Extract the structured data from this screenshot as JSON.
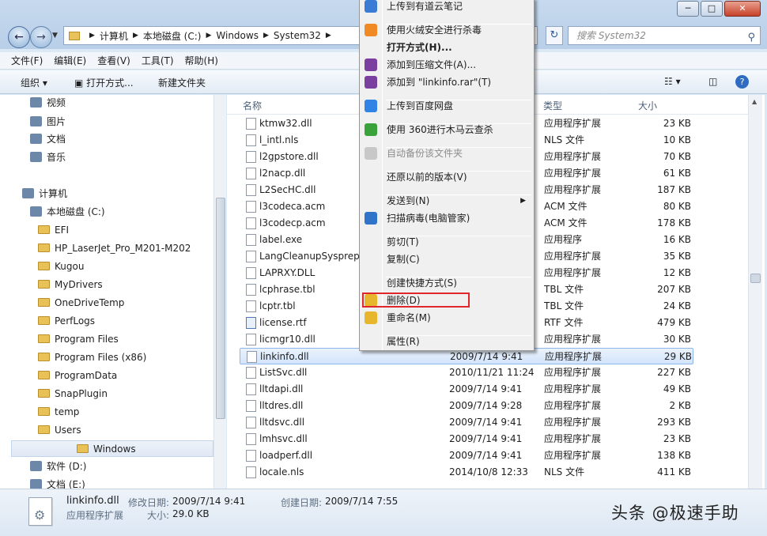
{
  "window": {
    "controls": [
      "─",
      "□",
      "✕"
    ]
  },
  "address": {
    "crumbs": [
      "计算机",
      "本地磁盘 (C:)",
      "Windows",
      "System32"
    ]
  },
  "search": {
    "placeholder": "搜索 System32"
  },
  "menubar": [
    "文件(F)",
    "编辑(E)",
    "查看(V)",
    "工具(T)",
    "帮助(H)"
  ],
  "toolbar": {
    "organize": "组织 ▾",
    "open": "打开方式...",
    "new_folder": "新建文件夹"
  },
  "nav": {
    "items": [
      {
        "label": "视频",
        "icon": "video-icon"
      },
      {
        "label": "图片",
        "icon": "picture-icon"
      },
      {
        "label": "文档",
        "icon": "document-icon"
      },
      {
        "label": "音乐",
        "icon": "music-icon"
      },
      {
        "label": "计算机",
        "icon": "computer-icon"
      },
      {
        "label": "本地磁盘 (C:)",
        "icon": "drive-icon"
      },
      {
        "label": "EFI",
        "icon": "folder-icon"
      },
      {
        "label": "HP_LaserJet_Pro_M201-M202",
        "icon": "folder-icon"
      },
      {
        "label": "Kugou",
        "icon": "folder-icon"
      },
      {
        "label": "MyDrivers",
        "icon": "folder-icon"
      },
      {
        "label": "OneDriveTemp",
        "icon": "folder-icon"
      },
      {
        "label": "PerfLogs",
        "icon": "folder-icon"
      },
      {
        "label": "Program Files",
        "icon": "folder-icon"
      },
      {
        "label": "Program Files (x86)",
        "icon": "folder-icon"
      },
      {
        "label": "ProgramData",
        "icon": "folder-icon"
      },
      {
        "label": "SnapPlugin",
        "icon": "folder-icon"
      },
      {
        "label": "temp",
        "icon": "folder-icon"
      },
      {
        "label": "Users",
        "icon": "folder-icon"
      },
      {
        "label": "Windows",
        "icon": "folder-icon"
      },
      {
        "label": "软件 (D:)",
        "icon": "drive-icon"
      },
      {
        "label": "文档 (E:)",
        "icon": "drive-icon"
      }
    ]
  },
  "columns": {
    "name": "名称",
    "type": "类型",
    "size": "大小"
  },
  "files": [
    {
      "name": "ktmw32.dll",
      "date": "",
      "type": "应用程序扩展",
      "size": "23 KB"
    },
    {
      "name": "l_intl.nls",
      "date": "",
      "type": "NLS 文件",
      "size": "10 KB"
    },
    {
      "name": "l2gpstore.dll",
      "date": "",
      "type": "应用程序扩展",
      "size": "70 KB"
    },
    {
      "name": "l2nacp.dll",
      "date": "",
      "type": "应用程序扩展",
      "size": "61 KB"
    },
    {
      "name": "L2SecHC.dll",
      "date": "",
      "type": "应用程序扩展",
      "size": "187 KB"
    },
    {
      "name": "l3codeca.acm",
      "date": "",
      "type": "ACM 文件",
      "size": "80 KB"
    },
    {
      "name": "l3codecp.acm",
      "date": "",
      "type": "ACM 文件",
      "size": "178 KB"
    },
    {
      "name": "label.exe",
      "date": "",
      "type": "应用程序",
      "size": "16 KB"
    },
    {
      "name": "LangCleanupSysprepA",
      "date": "",
      "type": "应用程序扩展",
      "size": "35 KB"
    },
    {
      "name": "LAPRXY.DLL",
      "date": "",
      "type": "应用程序扩展",
      "size": "12 KB"
    },
    {
      "name": "lcphrase.tbl",
      "date": "",
      "type": "TBL 文件",
      "size": "207 KB"
    },
    {
      "name": "lcptr.tbl",
      "date": "",
      "type": "TBL 文件",
      "size": "24 KB"
    },
    {
      "name": "license.rtf",
      "date": "",
      "type": "RTF 文件",
      "size": "479 KB"
    },
    {
      "name": "licmgr10.dll",
      "date": "",
      "type": "应用程序扩展",
      "size": "30 KB"
    },
    {
      "name": "linkinfo.dll",
      "date": "2009/7/14 9:41",
      "type": "应用程序扩展",
      "size": "29 KB"
    },
    {
      "name": "ListSvc.dll",
      "date": "2010/11/21 11:24",
      "type": "应用程序扩展",
      "size": "227 KB"
    },
    {
      "name": "lltdapi.dll",
      "date": "2009/7/14 9:41",
      "type": "应用程序扩展",
      "size": "49 KB"
    },
    {
      "name": "lltdres.dll",
      "date": "2009/7/14 9:28",
      "type": "应用程序扩展",
      "size": "2 KB"
    },
    {
      "name": "lltdsvc.dll",
      "date": "2009/7/14 9:41",
      "type": "应用程序扩展",
      "size": "293 KB"
    },
    {
      "name": "lmhsvc.dll",
      "date": "2009/7/14 9:41",
      "type": "应用程序扩展",
      "size": "23 KB"
    },
    {
      "name": "loadperf.dll",
      "date": "2009/7/14 9:41",
      "type": "应用程序扩展",
      "size": "138 KB"
    },
    {
      "name": "locale.nls",
      "date": "2014/10/8 12:33",
      "type": "NLS 文件",
      "size": "411 KB"
    }
  ],
  "context_menu": [
    {
      "label": "上传到有道云笔记",
      "icon": "youdao-icon"
    },
    {
      "label": "使用火绒安全进行杀毒",
      "icon": "huorong-icon"
    },
    {
      "label": "打开方式(H)...",
      "bold": true
    },
    {
      "label": "添加到压缩文件(A)...",
      "icon": "winrar-icon"
    },
    {
      "label": "添加到 \"linkinfo.rar\"(T)",
      "icon": "winrar-icon"
    },
    {
      "label": "上传到百度网盘",
      "icon": "baidu-icon"
    },
    {
      "label": "使用 360进行木马云查杀",
      "icon": "360-icon"
    },
    {
      "label": "自动备份该文件夹",
      "icon": "backup-icon",
      "disabled": true
    },
    {
      "label": "还原以前的版本(V)"
    },
    {
      "label": "发送到(N)",
      "submenu": true
    },
    {
      "label": "扫描病毒(电脑管家)",
      "icon": "shield-icon"
    },
    {
      "label": "剪切(T)"
    },
    {
      "label": "复制(C)"
    },
    {
      "label": "创建快捷方式(S)"
    },
    {
      "label": "删除(D)",
      "icon": "uac-shield-icon"
    },
    {
      "label": "重命名(M)",
      "icon": "uac-shield-icon"
    },
    {
      "label": "属性(R)"
    }
  ],
  "status": {
    "filename": "linkinfo.dll",
    "modified_label": "修改日期:",
    "modified_value": "2009/7/14 9:41",
    "created_label": "创建日期:",
    "created_value": "2009/7/14 7:55",
    "type_value": "应用程序扩展",
    "size_label": "大小:",
    "size_value": "29.0 KB"
  },
  "watermark": "头条 @极速手助",
  "colors": {
    "highlight_border": "#e0262a",
    "selection": "#d3e4fb",
    "window_frame": "#b9cfe8"
  }
}
